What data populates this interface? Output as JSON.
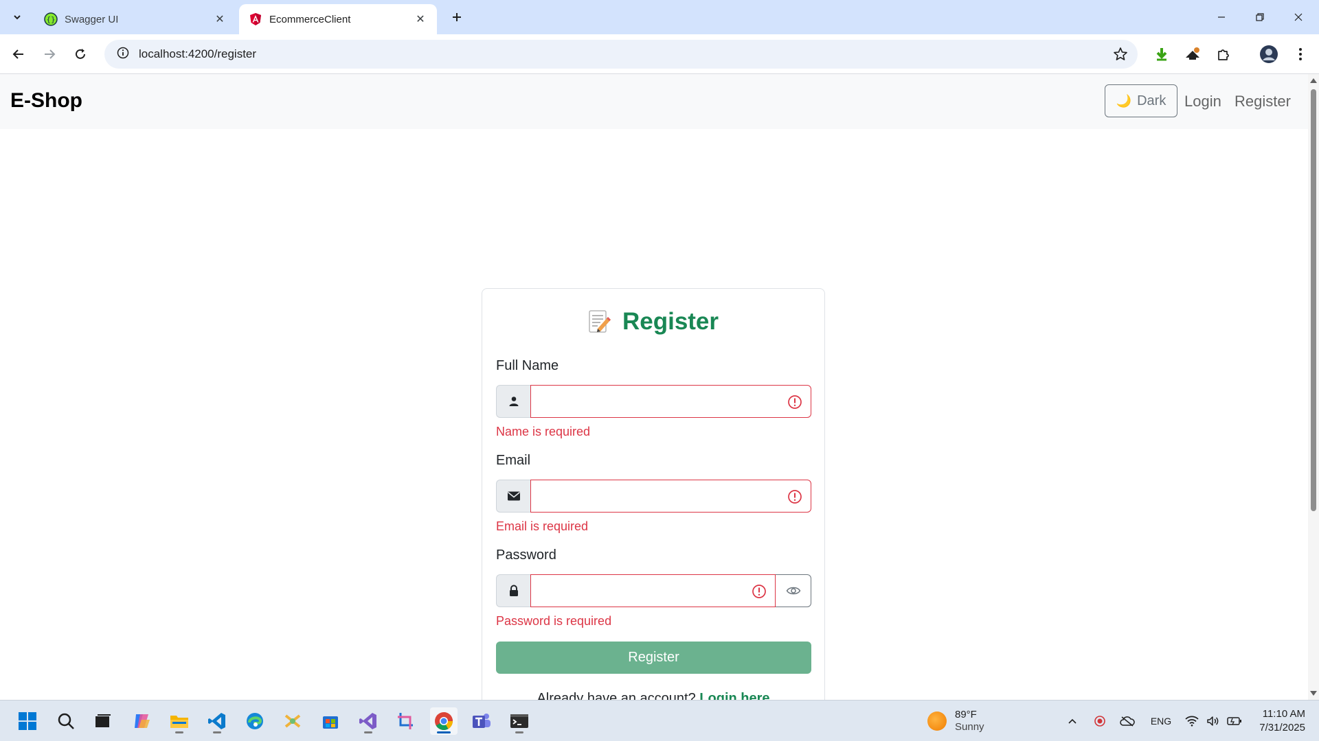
{
  "browser": {
    "tabs": [
      {
        "title": "Swagger UI",
        "favicon": "swagger-icon",
        "active": false
      },
      {
        "title": "EcommerceClient",
        "favicon": "angular-icon",
        "active": true
      }
    ],
    "url": "localhost:4200/register"
  },
  "navbar": {
    "brand": "E-Shop",
    "theme_toggle_label": "Dark",
    "links": [
      "Login",
      "Register"
    ]
  },
  "form": {
    "title": "Register",
    "title_icon": "memo-icon",
    "fields": [
      {
        "label": "Full Name",
        "icon": "person-icon",
        "value": "",
        "error": "Name is required"
      },
      {
        "label": "Email",
        "icon": "envelope-icon",
        "value": "",
        "error": "Email is required"
      },
      {
        "label": "Password",
        "icon": "lock-icon",
        "value": "",
        "error": "Password is required"
      }
    ],
    "submit_label": "Register",
    "footer_text": "Already have an account?",
    "footer_link": "Login here"
  },
  "taskbar": {
    "weather_temp": "89°F",
    "weather_cond": "Sunny",
    "language": "ENG",
    "time": "11:10 AM",
    "date": "7/31/2025"
  },
  "colors": {
    "brand_success": "#198754",
    "error": "#dc3545",
    "submit_bg": "#6bb28f"
  }
}
